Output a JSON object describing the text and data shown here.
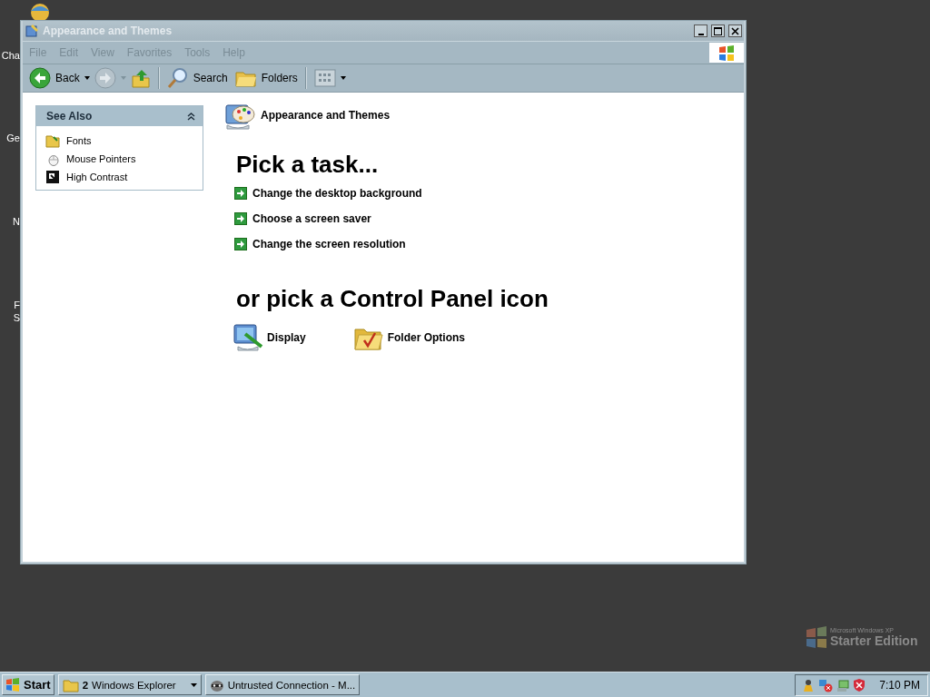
{
  "desktop_icons": [
    {
      "label": "Cha"
    },
    {
      "label": "Ge"
    },
    {
      "label": "N"
    },
    {
      "label": "F"
    },
    {
      "label": "S"
    }
  ],
  "window": {
    "title": "Appearance and Themes",
    "active": false,
    "menu": [
      "File",
      "Edit",
      "View",
      "Favorites",
      "Tools",
      "Help"
    ],
    "toolbar": [
      {
        "kind": "back",
        "label": "Back"
      },
      {
        "kind": "forward",
        "disabled": true
      },
      {
        "kind": "up"
      },
      {
        "kind": "separator"
      },
      {
        "kind": "search",
        "label": "Search"
      },
      {
        "kind": "folders",
        "label": "Folders"
      },
      {
        "kind": "separator"
      },
      {
        "kind": "views"
      }
    ],
    "see_also": {
      "title": "See Also",
      "expanded": true,
      "items": [
        {
          "kind": "fonts",
          "label": "Fonts"
        },
        {
          "kind": "mouse",
          "label": "Mouse Pointers"
        },
        {
          "kind": "contrast",
          "label": "High Contrast"
        }
      ]
    },
    "header": "Appearance and Themes",
    "task_heading": "Pick a task...",
    "tasks": [
      "Change the desktop background",
      "Choose a screen saver",
      "Change the screen resolution"
    ],
    "icon_heading": "or pick a Control Panel icon",
    "icons": [
      {
        "kind": "display",
        "label": "Display"
      },
      {
        "kind": "folder_options",
        "label": "Folder Options"
      }
    ]
  },
  "branding": {
    "line_1": "Microsoft Windows XP",
    "line_2": "Starter Edition"
  },
  "taskbar": {
    "start": "Start",
    "buttons": [
      {
        "kind": "group",
        "count": "2",
        "label": "Windows Explorer"
      },
      {
        "kind": "app",
        "label": "Untrusted Connection - M..."
      }
    ],
    "clock": "7:10 PM"
  }
}
